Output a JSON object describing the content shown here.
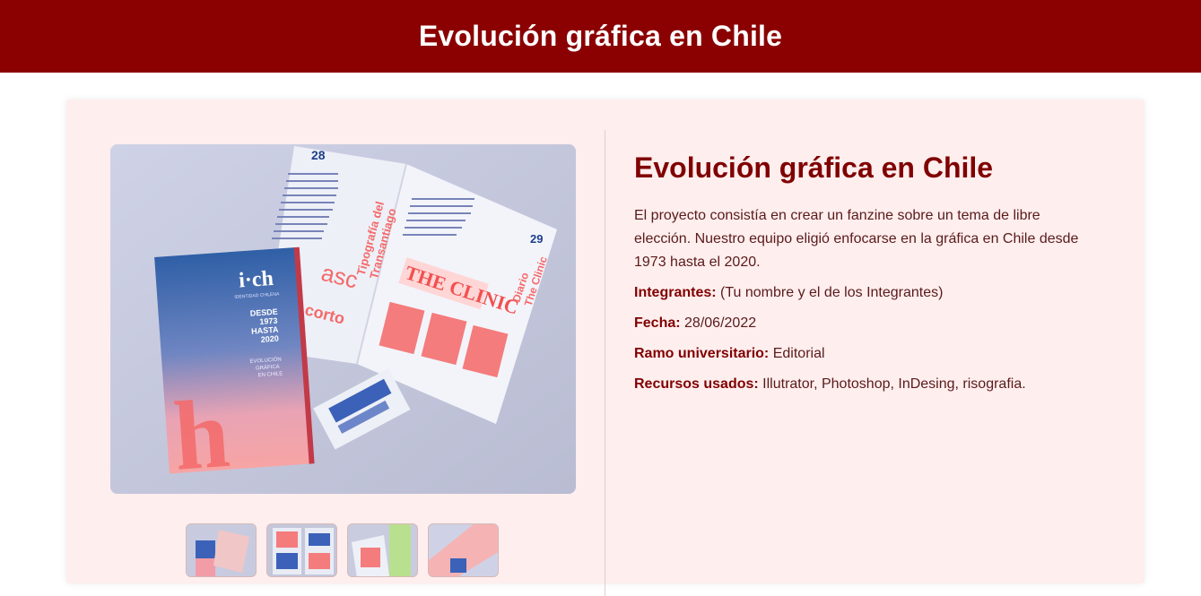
{
  "header": {
    "title": "Evolución gráfica en Chile"
  },
  "project": {
    "title": "Evolución gráfica en Chile",
    "description": "El proyecto consistía en crear un fanzine sobre un tema de libre elección. Nuestro equipo eligió enfocarse en la gráfica en Chile desde 1973 hasta el 2020.",
    "meta": [
      {
        "label": "Integrantes:",
        "value": "(Tu nombre y el de los Integrantes)"
      },
      {
        "label": "Fecha:",
        "value": "28/06/2022"
      },
      {
        "label": "Ramo universitario:",
        "value": "Editorial"
      },
      {
        "label": "Recursos usados:",
        "value": "Illutrator, Photoshop, InDesing, risografia."
      }
    ]
  },
  "photo": {
    "cover_logo": "i·ch",
    "cover_sub": "IDENTIDAD CHILENA",
    "cover_years": [
      "DESDE",
      "1973",
      "HASTA",
      "2020"
    ],
    "cover_caption": [
      "EVOLUCIÓN",
      "GRÁFICA",
      "EN CHILE"
    ],
    "page_left_number": "28",
    "page_right_number": "29",
    "page_left_heading": [
      "Tipografía del",
      "Transantiago"
    ],
    "page_right_heading": [
      "Diario",
      "The Clinic"
    ],
    "masthead": "THE CLINIC",
    "typeface_asc": "asc",
    "typeface_corto": "corto"
  },
  "thumbnails": [
    "Vista 1",
    "Vista 2",
    "Vista 3",
    "Vista 4"
  ],
  "colors": {
    "header_bg": "#8b0000",
    "title": "#800000",
    "card_bg": "#ffeeee"
  }
}
